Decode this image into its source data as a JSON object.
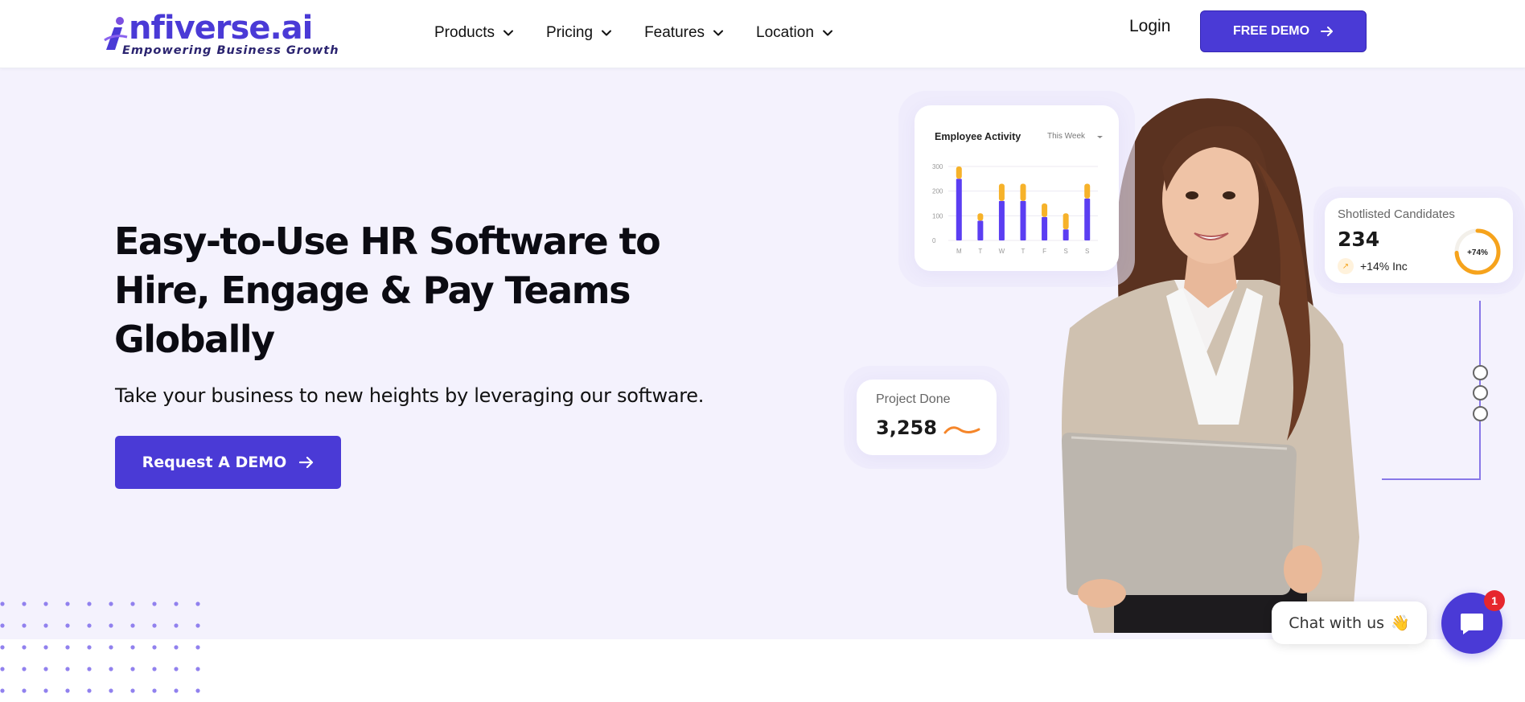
{
  "brand": {
    "name": "nfiverse.ai",
    "tagline": "Empowering Business Growth",
    "accent": "#4a3ad6"
  },
  "nav": {
    "items": [
      {
        "label": "Products",
        "icon": "chevron-down-icon"
      },
      {
        "label": "Pricing",
        "icon": "chevron-down-icon"
      },
      {
        "label": "Features",
        "icon": "chevron-down-icon"
      },
      {
        "label": "Location",
        "icon": "chevron-down-icon"
      }
    ],
    "login_label": "Login",
    "free_demo_label": "FREE DEMO"
  },
  "hero": {
    "headline_lines": [
      "Easy-to-Use HR Software to",
      "Hire, Engage & Pay Teams",
      "Globally"
    ],
    "subline": "Take your business to new heights by leveraging our software.",
    "cta_label": "Request A DEMO",
    "background": "#f4f2fd"
  },
  "cards": {
    "employee_activity": {
      "title": "Employee Activity",
      "period": "This Week",
      "chart_data": {
        "type": "bar",
        "stacked": true,
        "categories": [
          "M",
          "T",
          "W",
          "T",
          "F",
          "S",
          "S"
        ],
        "y_ticks": [
          "300",
          "200",
          "100",
          "0"
        ],
        "ylim": [
          0,
          300
        ],
        "grid": true,
        "series": [
          {
            "color": "#5b3ef2",
            "values": [
              250,
              80,
              160,
              160,
              95,
              45,
              170
            ]
          },
          {
            "color": "#f6b22a",
            "values": [
              50,
              30,
              70,
              70,
              55,
              65,
              60
            ]
          }
        ]
      }
    },
    "project_done": {
      "label": "Project Done",
      "value": "3,258",
      "icon": "trend-wave-icon"
    },
    "shortlisted": {
      "label": "Shotlisted Candidates",
      "value": "234",
      "increase": "+14% Inc",
      "ring_label": "+74%",
      "ring_fraction": 0.74,
      "ring_color": "#f6a31c"
    }
  },
  "chat": {
    "label": "Chat with us",
    "emoji": "👋",
    "badge_count": "1"
  }
}
